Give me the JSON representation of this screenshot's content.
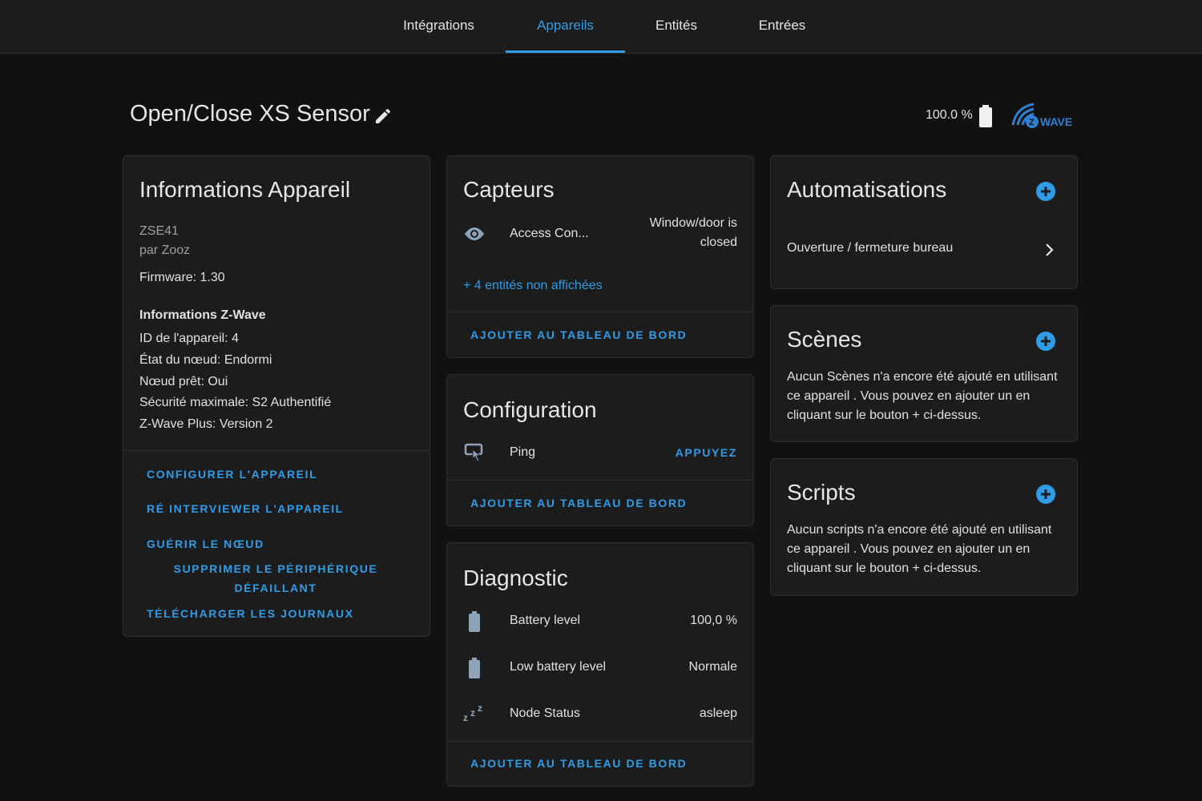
{
  "tabs": [
    {
      "label": "Intégrations",
      "active": false
    },
    {
      "label": "Appareils",
      "active": true
    },
    {
      "label": "Entités",
      "active": false
    },
    {
      "label": "Entrées",
      "active": false
    }
  ],
  "header": {
    "title": "Open/Close XS Sensor",
    "battery_text": "100.0 %",
    "logo_text": "WAVE",
    "logo_letter": "Z"
  },
  "device_info": {
    "title": "Informations Appareil",
    "model": "ZSE41",
    "manufacturer": "par Zooz",
    "firmware": "Firmware: 1.30",
    "zwave_heading": "Informations Z-Wave",
    "zwave_lines": [
      "ID de l'appareil: 4",
      "État du nœud: Endormi",
      "Nœud prêt: Oui",
      "Sécurité maximale: S2 Authentifié",
      "Z-Wave Plus: Version 2"
    ],
    "actions": [
      "CONFIGURER L'APPAREIL",
      "RÉ INTERVIEWER L'APPAREIL",
      "GUÉRIR LE NŒUD",
      "SUPPRIMER LE PÉRIPHÉRIQUE",
      "DÉFAILLANT",
      "TÉLÉCHARGER LES JOURNAUX"
    ]
  },
  "sensors": {
    "title": "Capteurs",
    "entity_name": "Access Con...",
    "entity_state_line1": "Window/door is",
    "entity_state_line2": "closed",
    "hidden_link": "+ 4 entités non affichées",
    "add_to_dashboard": "AJOUTER AU TABLEAU DE BORD"
  },
  "configuration": {
    "title": "Configuration",
    "entity_name": "Ping",
    "press_label": "APPUYEZ",
    "add_to_dashboard": "AJOUTER AU TABLEAU DE BORD"
  },
  "diagnostic": {
    "title": "Diagnostic",
    "rows": [
      {
        "name": "Battery level",
        "value": "100,0 %"
      },
      {
        "name": "Low battery level",
        "value": "Normale"
      },
      {
        "name": "Node Status",
        "value": "asleep"
      }
    ],
    "add_to_dashboard": "AJOUTER AU TABLEAU DE BORD"
  },
  "automations": {
    "title": "Automatisations",
    "item": "Ouverture / fermeture bureau"
  },
  "scenes": {
    "title": "Scènes",
    "description": "Aucun Scènes n'a encore été ajouté en utilisant ce appareil . Vous pouvez en ajouter un en cliquant sur le bouton + ci-dessus."
  },
  "scripts": {
    "title": "Scripts",
    "description": "Aucun scripts n'a encore été ajouté en utilisant ce appareil . Vous pouvez en ajouter un en cliquant sur le bouton + ci-dessus."
  },
  "colors": {
    "accent": "#2f9ce8",
    "background": "#111111",
    "card": "#1c1c1c",
    "icon_muted": "#8ea3b8"
  },
  "icons": {
    "edit": "pencil-icon",
    "battery": "battery-icon",
    "eye": "eye-icon",
    "ping": "touch-button-icon",
    "sleep": "sleep-zzz-icon",
    "plus": "plus-circle-icon",
    "chevron": "chevron-right-icon"
  }
}
